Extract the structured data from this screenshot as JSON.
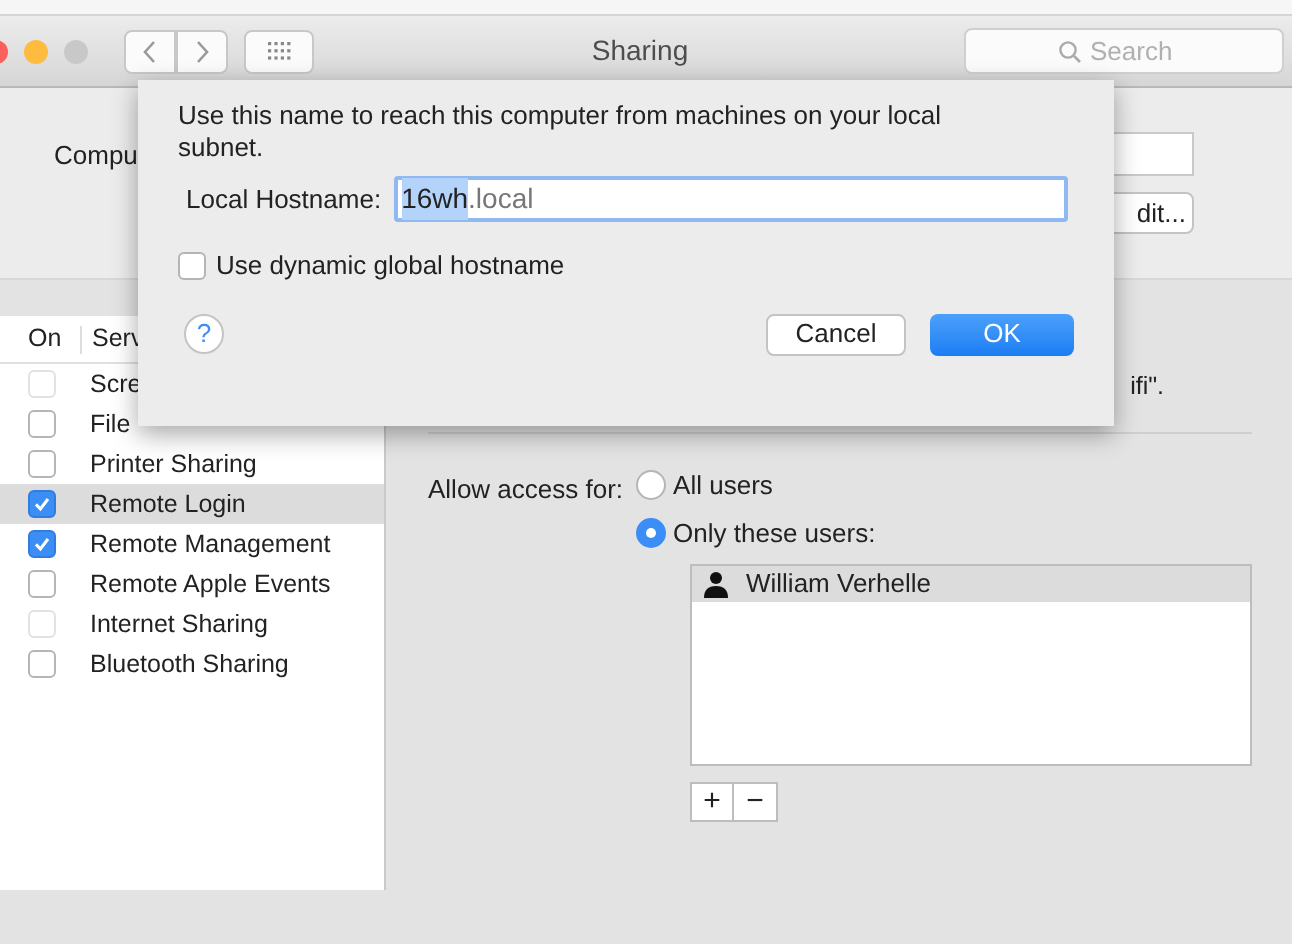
{
  "window": {
    "title": "Sharing"
  },
  "search": {
    "placeholder": "Search"
  },
  "computer_name": {
    "label": "Compu",
    "button": "dit..."
  },
  "services": {
    "columns": [
      "On",
      "Serv"
    ],
    "items": [
      {
        "name": "Scre",
        "checked": false,
        "disabled": true,
        "selected": false
      },
      {
        "name": "File",
        "checked": false,
        "disabled": false,
        "selected": false
      },
      {
        "name": "Printer Sharing",
        "checked": false,
        "disabled": false,
        "selected": false
      },
      {
        "name": "Remote Login",
        "checked": true,
        "disabled": false,
        "selected": true
      },
      {
        "name": "Remote Management",
        "checked": true,
        "disabled": false,
        "selected": false
      },
      {
        "name": "Remote Apple Events",
        "checked": false,
        "disabled": false,
        "selected": false
      },
      {
        "name": "Internet Sharing",
        "checked": false,
        "disabled": true,
        "selected": false
      },
      {
        "name": "Bluetooth Sharing",
        "checked": false,
        "disabled": false,
        "selected": false
      }
    ]
  },
  "status_text": "ifi\".",
  "access": {
    "label": "Allow access for:",
    "options": [
      {
        "label": "All users",
        "selected": false
      },
      {
        "label": "Only these users:",
        "selected": true
      }
    ],
    "users": [
      {
        "name": "William Verhelle",
        "selected": true
      }
    ],
    "add": "+",
    "remove": "−"
  },
  "dialog": {
    "message": "Use this name to reach this computer from machines on your local subnet.",
    "hostname_label": "Local Hostname:",
    "hostname_selected": "16wh",
    "hostname_suffix": ".local",
    "dynamic": {
      "label": "Use dynamic global hostname",
      "checked": false
    },
    "help": "?",
    "cancel": "Cancel",
    "ok": "OK"
  }
}
